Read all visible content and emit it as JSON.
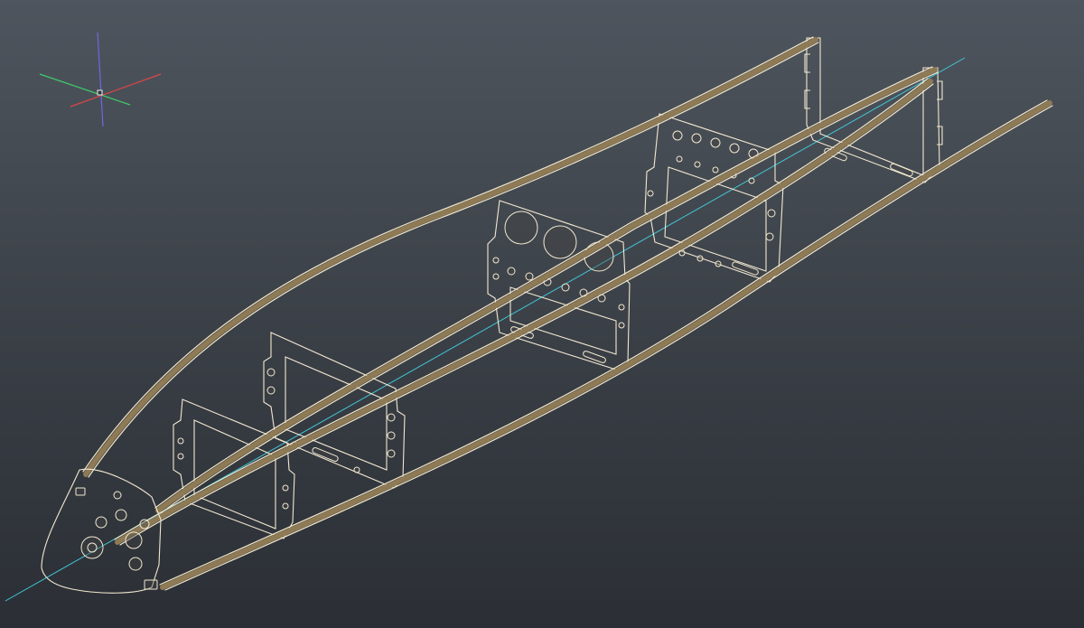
{
  "viewport": {
    "background_top": "#4f555e",
    "background_bottom": "#2b2f35"
  },
  "view_cube": {
    "axes": [
      "x-axis",
      "y-axis",
      "z-axis"
    ],
    "colors": {
      "x": "#d84848",
      "y": "#3ec86a",
      "z": "#6a6ae0"
    }
  },
  "model": {
    "material_color": "#b49664",
    "edge_color": "#f2e8d0",
    "centerline_color": "#40c8d8",
    "bulkheads": [
      "firewall",
      "bulkhead-2",
      "bulkhead-3",
      "bulkhead-4",
      "bulkhead-5",
      "bulkhead-6"
    ],
    "stringers": [
      "top-left",
      "top-right",
      "bottom-left",
      "bottom-right"
    ]
  }
}
